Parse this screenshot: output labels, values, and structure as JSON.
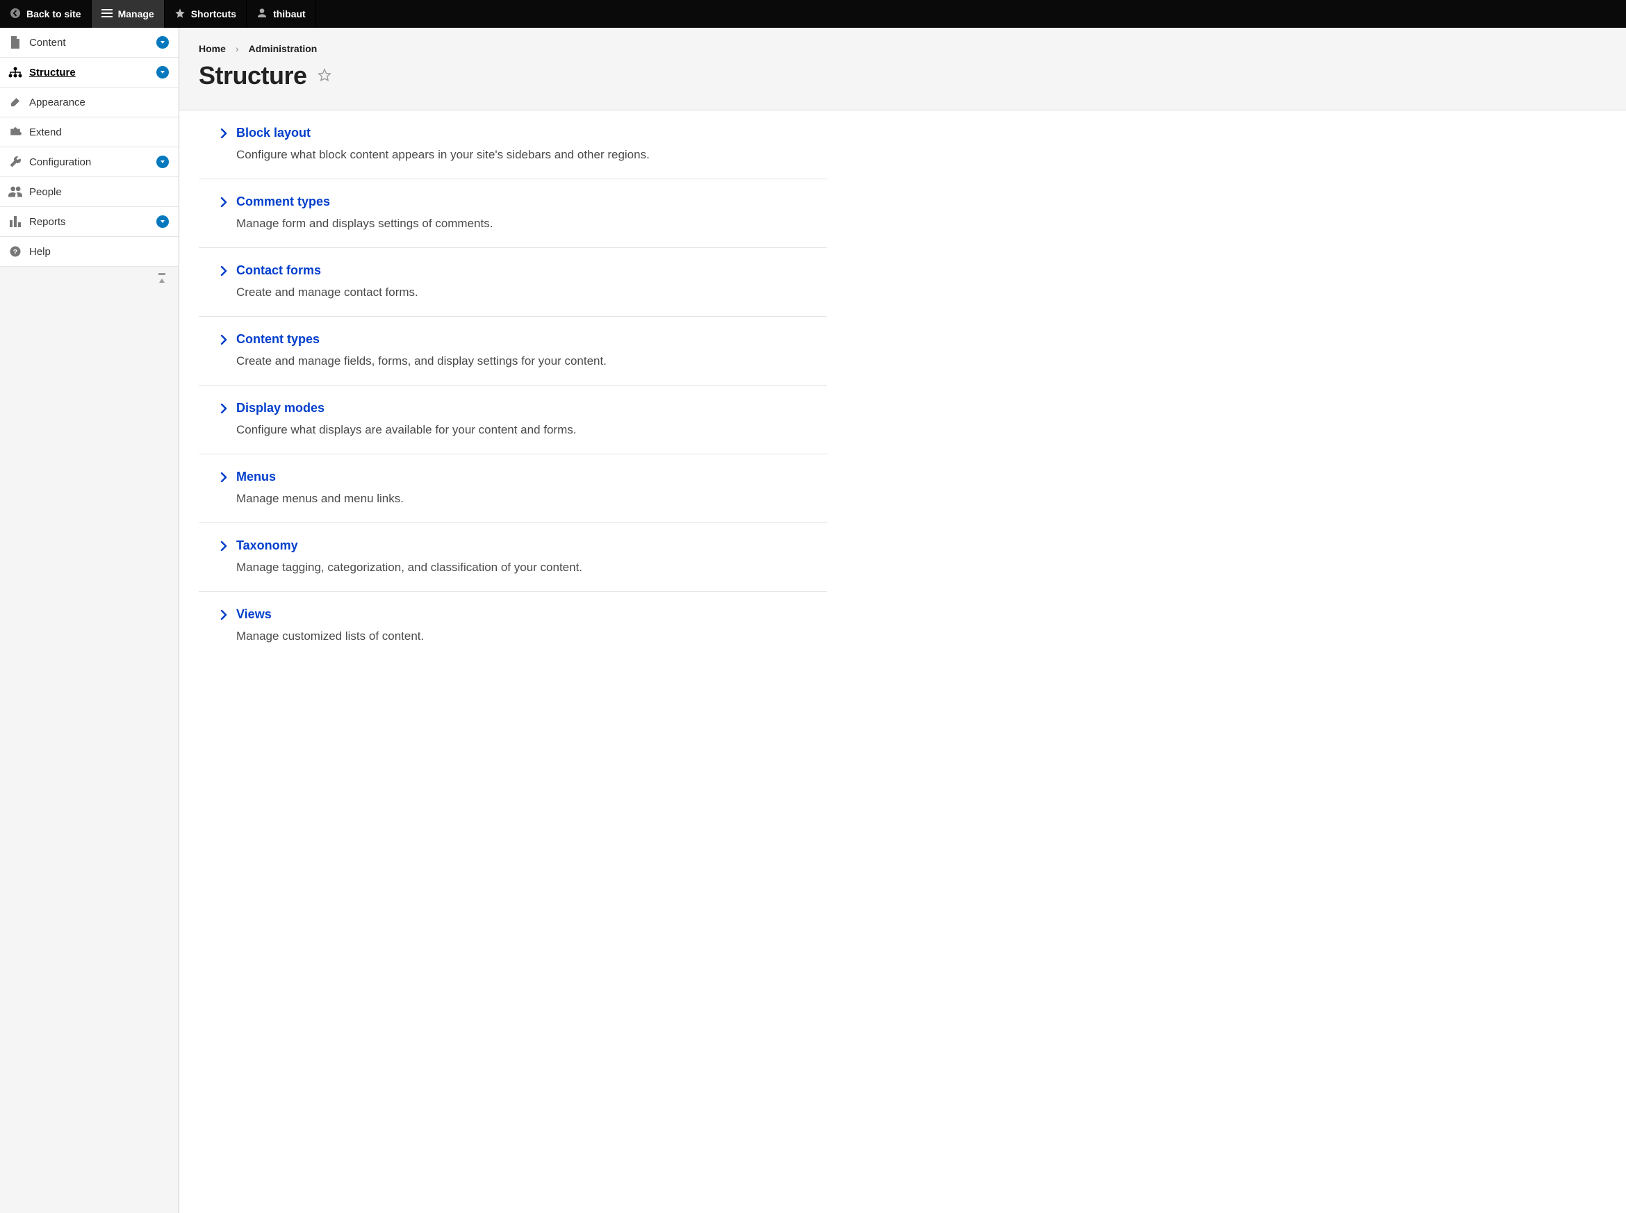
{
  "topbar": {
    "back": "Back to site",
    "manage": "Manage",
    "shortcuts": "Shortcuts",
    "user": "thibaut"
  },
  "sidebar": {
    "items": [
      {
        "label": "Content",
        "icon": "page",
        "expandable": true,
        "active": false
      },
      {
        "label": "Structure",
        "icon": "hierarchy",
        "expandable": true,
        "active": true
      },
      {
        "label": "Appearance",
        "icon": "brush",
        "expandable": false,
        "active": false
      },
      {
        "label": "Extend",
        "icon": "puzzle",
        "expandable": false,
        "active": false
      },
      {
        "label": "Configuration",
        "icon": "wrench",
        "expandable": true,
        "active": false
      },
      {
        "label": "People",
        "icon": "people",
        "expandable": false,
        "active": false
      },
      {
        "label": "Reports",
        "icon": "bars",
        "expandable": true,
        "active": false
      },
      {
        "label": "Help",
        "icon": "help",
        "expandable": false,
        "active": false
      }
    ]
  },
  "breadcrumb": [
    "Home",
    "Administration"
  ],
  "page_title": "Structure",
  "admin_items": [
    {
      "title": "Block layout",
      "desc": "Configure what block content appears in your site's sidebars and other regions."
    },
    {
      "title": "Comment types",
      "desc": "Manage form and displays settings of comments."
    },
    {
      "title": "Contact forms",
      "desc": "Create and manage contact forms."
    },
    {
      "title": "Content types",
      "desc": "Create and manage fields, forms, and display settings for your content."
    },
    {
      "title": "Display modes",
      "desc": "Configure what displays are available for your content and forms."
    },
    {
      "title": "Menus",
      "desc": "Manage menus and menu links."
    },
    {
      "title": "Taxonomy",
      "desc": "Manage tagging, categorization, and classification of your content."
    },
    {
      "title": "Views",
      "desc": "Manage customized lists of content."
    }
  ]
}
